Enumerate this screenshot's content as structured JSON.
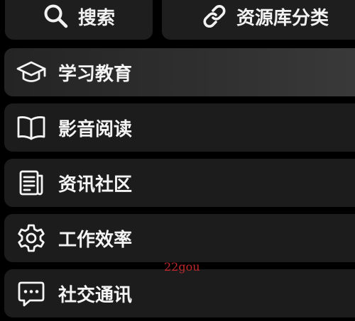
{
  "top_bar": {
    "search": {
      "label": "搜索",
      "icon": "search-icon"
    },
    "category": {
      "label": "资源库分类",
      "icon": "link-icon"
    }
  },
  "menu": {
    "items": [
      {
        "label": "学习教育",
        "icon": "graduation-cap-icon",
        "active": true
      },
      {
        "label": "影音阅读",
        "icon": "book-icon",
        "active": false
      },
      {
        "label": "资讯社区",
        "icon": "newspaper-icon",
        "active": false
      },
      {
        "label": "工作效率",
        "icon": "gear-icon",
        "active": false
      },
      {
        "label": "社交通讯",
        "icon": "chat-bubble-icon",
        "active": false
      }
    ]
  },
  "watermark": {
    "text": "22gou"
  },
  "colors": {
    "background": "#000000",
    "button": "#1e1e1e",
    "text": "#f4f4f4",
    "watermark": "#c0282c"
  }
}
